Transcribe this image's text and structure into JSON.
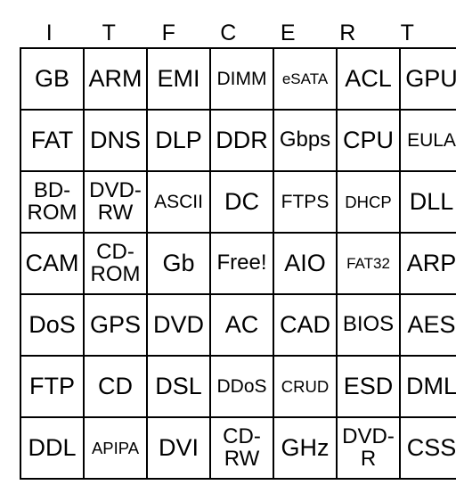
{
  "card": {
    "header_letters": [
      "I",
      "T",
      "F",
      "C",
      "E",
      "R",
      "T"
    ],
    "rows": [
      [
        {
          "text": "GB",
          "size": "xl"
        },
        {
          "text": "ARM",
          "size": "xl"
        },
        {
          "text": "EMI",
          "size": "xl"
        },
        {
          "text": "DIMM",
          "size": "md"
        },
        {
          "text": "eSATA",
          "size": "xs"
        },
        {
          "text": "ACL",
          "size": "xl"
        },
        {
          "text": "GPU",
          "size": "xl"
        }
      ],
      [
        {
          "text": "FAT",
          "size": "xl"
        },
        {
          "text": "DNS",
          "size": "xl"
        },
        {
          "text": "DLP",
          "size": "xl"
        },
        {
          "text": "DDR",
          "size": "xl"
        },
        {
          "text": "Gbps",
          "size": "lg"
        },
        {
          "text": "CPU",
          "size": "xl"
        },
        {
          "text": "EULA",
          "size": "md"
        }
      ],
      [
        {
          "text": "BD-ROM",
          "size": "2l"
        },
        {
          "text": "DVD-RW",
          "size": "2l"
        },
        {
          "text": "ASCII",
          "size": "md"
        },
        {
          "text": "DC",
          "size": "xl"
        },
        {
          "text": "FTPS",
          "size": "md"
        },
        {
          "text": "DHCP",
          "size": "sm"
        },
        {
          "text": "DLL",
          "size": "xl"
        }
      ],
      [
        {
          "text": "CAM",
          "size": "xl"
        },
        {
          "text": "CD-ROM",
          "size": "2l"
        },
        {
          "text": "Gb",
          "size": "xl"
        },
        {
          "text": "Free!",
          "size": "lg"
        },
        {
          "text": "AIO",
          "size": "xl"
        },
        {
          "text": "FAT32",
          "size": "xs"
        },
        {
          "text": "ARP",
          "size": "xl"
        }
      ],
      [
        {
          "text": "DoS",
          "size": "xl"
        },
        {
          "text": "GPS",
          "size": "xl"
        },
        {
          "text": "DVD",
          "size": "xl"
        },
        {
          "text": "AC",
          "size": "xl"
        },
        {
          "text": "CAD",
          "size": "xl"
        },
        {
          "text": "BIOS",
          "size": "lg"
        },
        {
          "text": "AES",
          "size": "xl"
        }
      ],
      [
        {
          "text": "FTP",
          "size": "xl"
        },
        {
          "text": "CD",
          "size": "xl"
        },
        {
          "text": "DSL",
          "size": "xl"
        },
        {
          "text": "DDoS",
          "size": "md"
        },
        {
          "text": "CRUD",
          "size": "sm"
        },
        {
          "text": "ESD",
          "size": "xl"
        },
        {
          "text": "DML",
          "size": "xl"
        }
      ],
      [
        {
          "text": "DDL",
          "size": "xl"
        },
        {
          "text": "APIPA",
          "size": "sm"
        },
        {
          "text": "DVI",
          "size": "xl"
        },
        {
          "text": "CD-RW",
          "size": "2l"
        },
        {
          "text": "GHz",
          "size": "xl"
        },
        {
          "text": "DVD-R",
          "size": "2l"
        },
        {
          "text": "CSS",
          "size": "xl"
        }
      ]
    ]
  }
}
